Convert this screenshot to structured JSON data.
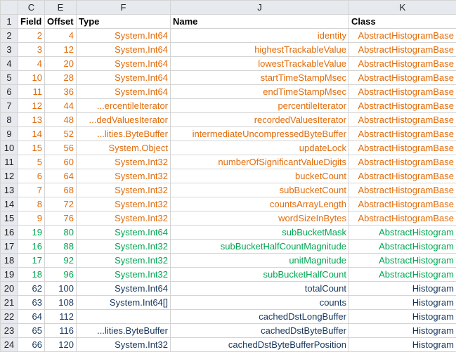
{
  "columns": [
    "C",
    "E",
    "F",
    "J",
    "K"
  ],
  "header_row": {
    "row": "1",
    "field": "Field",
    "offset": "Offset",
    "type": "Type",
    "name": "Name",
    "class": "Class"
  },
  "colors": {
    "orange": "#e26b0a",
    "green": "#00a651",
    "navy": "#17375e",
    "header_bg": "#e6e9ee",
    "gridline": "#d4d4d4"
  },
  "rows": [
    {
      "row": "2",
      "field": "2",
      "offset": "4",
      "type": "System.Int64",
      "name": "identity",
      "class": "AbstractHistogramBase",
      "color": "orange"
    },
    {
      "row": "3",
      "field": "3",
      "offset": "12",
      "type": "System.Int64",
      "name": "highestTrackableValue",
      "class": "AbstractHistogramBase",
      "color": "orange"
    },
    {
      "row": "4",
      "field": "4",
      "offset": "20",
      "type": "System.Int64",
      "name": "lowestTrackableValue",
      "class": "AbstractHistogramBase",
      "color": "orange"
    },
    {
      "row": "5",
      "field": "10",
      "offset": "28",
      "type": "System.Int64",
      "name": "startTimeStampMsec",
      "class": "AbstractHistogramBase",
      "color": "orange"
    },
    {
      "row": "6",
      "field": "11",
      "offset": "36",
      "type": "System.Int64",
      "name": "endTimeStampMsec",
      "class": "AbstractHistogramBase",
      "color": "orange"
    },
    {
      "row": "7",
      "field": "12",
      "offset": "44",
      "type": "...ercentileIterator",
      "name": "percentileIterator",
      "class": "AbstractHistogramBase",
      "color": "orange"
    },
    {
      "row": "8",
      "field": "13",
      "offset": "48",
      "type": "...dedValuesIterator",
      "name": "recordedValuesIterator",
      "class": "AbstractHistogramBase",
      "color": "orange"
    },
    {
      "row": "9",
      "field": "14",
      "offset": "52",
      "type": "...lities.ByteBuffer",
      "name": "intermediateUncompressedByteBuffer",
      "class": "AbstractHistogramBase",
      "color": "orange"
    },
    {
      "row": "10",
      "field": "15",
      "offset": "56",
      "type": "System.Object",
      "name": "updateLock",
      "class": "AbstractHistogramBase",
      "color": "orange"
    },
    {
      "row": "11",
      "field": "5",
      "offset": "60",
      "type": "System.Int32",
      "name": "numberOfSignificantValueDigits",
      "class": "AbstractHistogramBase",
      "color": "orange"
    },
    {
      "row": "12",
      "field": "6",
      "offset": "64",
      "type": "System.Int32",
      "name": "bucketCount",
      "class": "AbstractHistogramBase",
      "color": "orange"
    },
    {
      "row": "13",
      "field": "7",
      "offset": "68",
      "type": "System.Int32",
      "name": "subBucketCount",
      "class": "AbstractHistogramBase",
      "color": "orange"
    },
    {
      "row": "14",
      "field": "8",
      "offset": "72",
      "type": "System.Int32",
      "name": "countsArrayLength",
      "class": "AbstractHistogramBase",
      "color": "orange"
    },
    {
      "row": "15",
      "field": "9",
      "offset": "76",
      "type": "System.Int32",
      "name": "wordSizeInBytes",
      "class": "AbstractHistogramBase",
      "color": "orange"
    },
    {
      "row": "16",
      "field": "19",
      "offset": "80",
      "type": "System.Int64",
      "name": "subBucketMask",
      "class": "AbstractHistogram",
      "color": "green"
    },
    {
      "row": "17",
      "field": "16",
      "offset": "88",
      "type": "System.Int32",
      "name": "subBucketHalfCountMagnitude",
      "class": "AbstractHistogram",
      "color": "green"
    },
    {
      "row": "18",
      "field": "17",
      "offset": "92",
      "type": "System.Int32",
      "name": "unitMagnitude",
      "class": "AbstractHistogram",
      "color": "green"
    },
    {
      "row": "19",
      "field": "18",
      "offset": "96",
      "type": "System.Int32",
      "name": "subBucketHalfCount",
      "class": "AbstractHistogram",
      "color": "green"
    },
    {
      "row": "20",
      "field": "62",
      "offset": "100",
      "type": "System.Int64",
      "name": "totalCount",
      "class": "Histogram",
      "color": "navy"
    },
    {
      "row": "21",
      "field": "63",
      "offset": "108",
      "type": "System.Int64[]",
      "name": "counts",
      "class": "Histogram",
      "color": "navy"
    },
    {
      "row": "22",
      "field": "64",
      "offset": "112",
      "type": "",
      "name": "cachedDstLongBuffer",
      "class": "Histogram",
      "color": "navy"
    },
    {
      "row": "23",
      "field": "65",
      "offset": "116",
      "type": "...lities.ByteBuffer",
      "name": "cachedDstByteBuffer",
      "class": "Histogram",
      "color": "navy"
    },
    {
      "row": "24",
      "field": "66",
      "offset": "120",
      "type": "System.Int32",
      "name": "cachedDstByteBufferPosition",
      "class": "Histogram",
      "color": "navy"
    }
  ]
}
